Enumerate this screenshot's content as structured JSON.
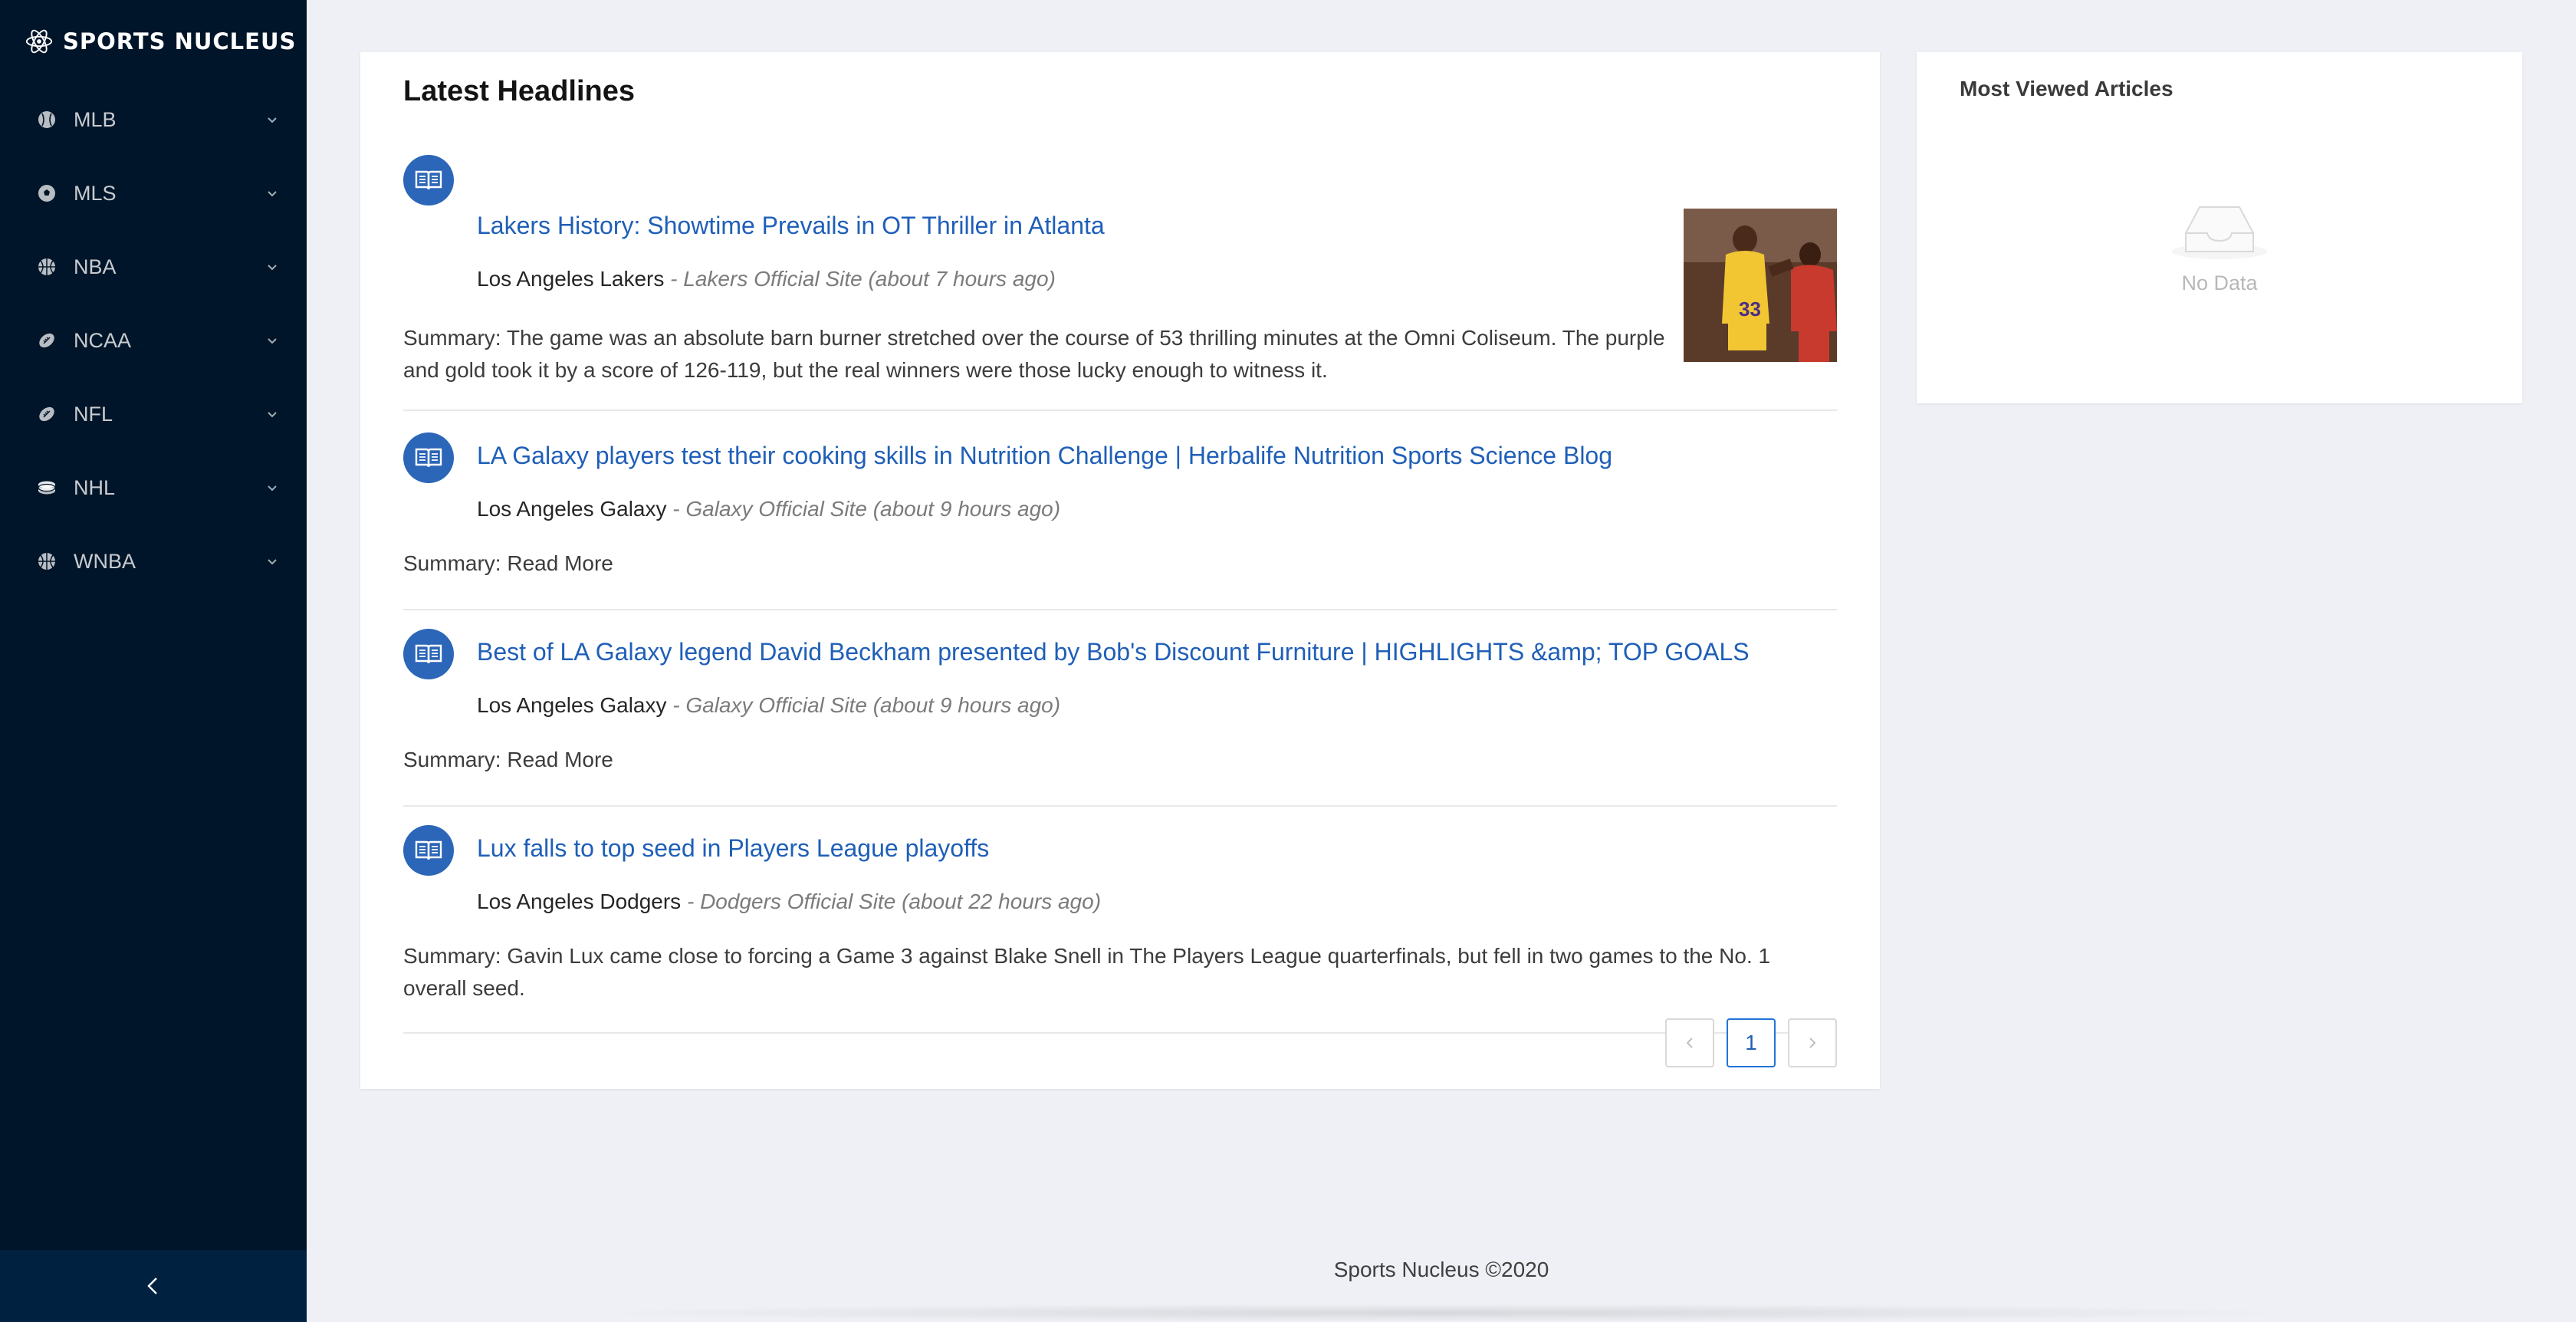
{
  "app": {
    "brand": "SPORTS NUCLEUS"
  },
  "sidebar": {
    "items": [
      {
        "label": "MLB",
        "icon": "baseball-icon"
      },
      {
        "label": "MLS",
        "icon": "soccer-ball-icon"
      },
      {
        "label": "NBA",
        "icon": "basketball-icon"
      },
      {
        "label": "NCAA",
        "icon": "football-icon"
      },
      {
        "label": "NFL",
        "icon": "football-icon"
      },
      {
        "label": "NHL",
        "icon": "hockey-puck-icon"
      },
      {
        "label": "WNBA",
        "icon": "basketball-icon"
      }
    ],
    "collapse_icon": "chevron-left-icon"
  },
  "headlines": {
    "title": "Latest Headlines",
    "articles": [
      {
        "title": "Lakers History: Showtime Prevails in OT Thriller in Atlanta",
        "team": "Los Angeles Lakers",
        "source": "- Lakers Official Site (about 7 hours ago)",
        "summary": "Summary: The game was an absolute barn burner stretched over the course of 53 thrilling minutes at the Omni Coliseum. The purple and gold took it by a score of 126-119, but the real winners were those lucky enough to witness it."
      },
      {
        "title": "LA Galaxy players test their cooking skills in Nutrition Challenge | Herbalife Nutrition Sports Science Blog",
        "team": "Los Angeles Galaxy",
        "source": "- Galaxy Official Site (about 9 hours ago)",
        "summary": "Summary: Read More"
      },
      {
        "title": "Best of LA Galaxy legend David Beckham presented by Bob's Discount Furniture | HIGHLIGHTS &amp; TOP GOALS",
        "team": "Los Angeles Galaxy",
        "source": "- Galaxy Official Site (about 9 hours ago)",
        "summary": "Summary: Read More"
      },
      {
        "title": "Lux falls to top seed in Players League playoffs",
        "team": "Los Angeles Dodgers",
        "source": "- Dodgers Official Site (about 22 hours ago)",
        "summary": "Summary: Gavin Lux came close to forcing a Game 3 against Blake Snell in The Players League quarterfinals, but fell in two games to the No. 1 overall seed."
      }
    ],
    "pagination": {
      "current": "1"
    }
  },
  "most_viewed": {
    "title": "Most Viewed Articles",
    "empty_text": "No Data"
  },
  "footer": {
    "text": "Sports Nucleus ©2020"
  },
  "colors": {
    "sidebar_bg": "#001529",
    "collapse_bg": "#002140",
    "link": "#1f5fb8",
    "avatar": "#2c66b8",
    "page_bg": "#eef0f5"
  }
}
